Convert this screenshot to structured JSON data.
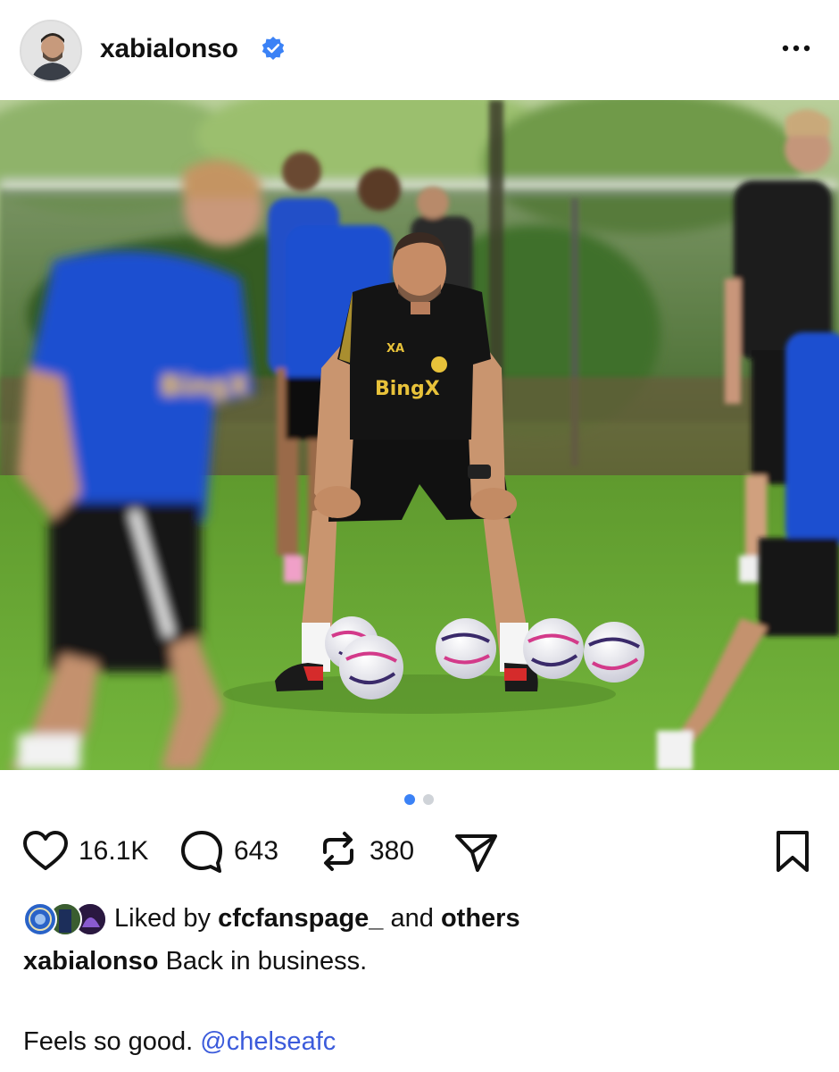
{
  "post": {
    "username": "xabialonso",
    "verified": true,
    "more_icon": "more-horizontal-icon"
  },
  "carousel": {
    "current": 1,
    "total": 2
  },
  "actions": {
    "likes": "16.1K",
    "comments": "643",
    "reposts": "380"
  },
  "liked_by": {
    "prefix": "Liked by",
    "user": "cfcfanspage_",
    "middle": "and",
    "suffix": "others"
  },
  "caption": {
    "username": "xabialonso",
    "text": "Back in business.",
    "line2": "Feels so good.",
    "mention": "@chelseafc"
  },
  "colors": {
    "accent": "#3b82f6",
    "mention": "#3b5bdb",
    "grass": "#6aa43a",
    "kit_blue": "#1d4fd8",
    "kit_black": "#141414"
  }
}
